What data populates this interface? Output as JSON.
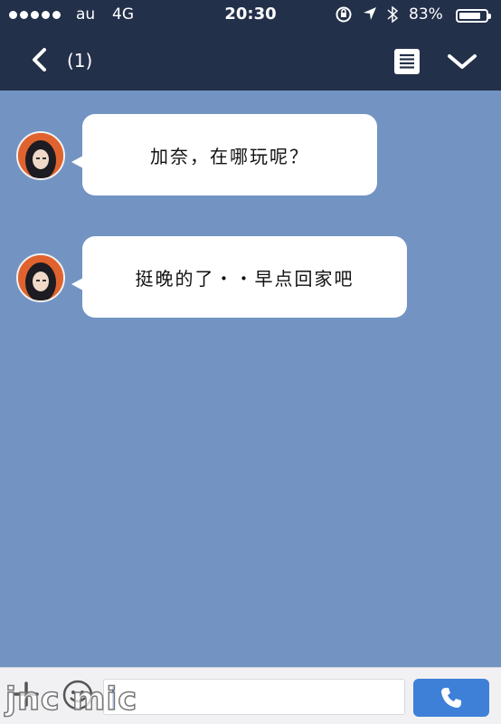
{
  "status_bar": {
    "carrier": "au",
    "network": "4G",
    "time": "20:30",
    "battery_percent": "83%",
    "battery_level": 0.83,
    "icons": [
      "signal-dots-icon",
      "rotation-lock-icon",
      "location-arrow-icon",
      "bluetooth-icon",
      "battery-icon"
    ]
  },
  "nav_bar": {
    "unread_count": "(1)",
    "icons": [
      "back-icon",
      "memo-icon",
      "dropdown-icon"
    ]
  },
  "messages": [
    {
      "text": "加奈，在哪玩呢？",
      "sender": "incoming"
    },
    {
      "text": "挺晚的了・・早点回家吧",
      "sender": "incoming"
    }
  ],
  "input_bar": {
    "icons": [
      "plus-icon",
      "emoji-icon",
      "phone-icon"
    ],
    "watermark": "jnc mic"
  },
  "colors": {
    "chat_background": "#7394c3",
    "header": "#23304a",
    "call_button": "#3e80d8",
    "avatar_ring": "#e0632f"
  }
}
